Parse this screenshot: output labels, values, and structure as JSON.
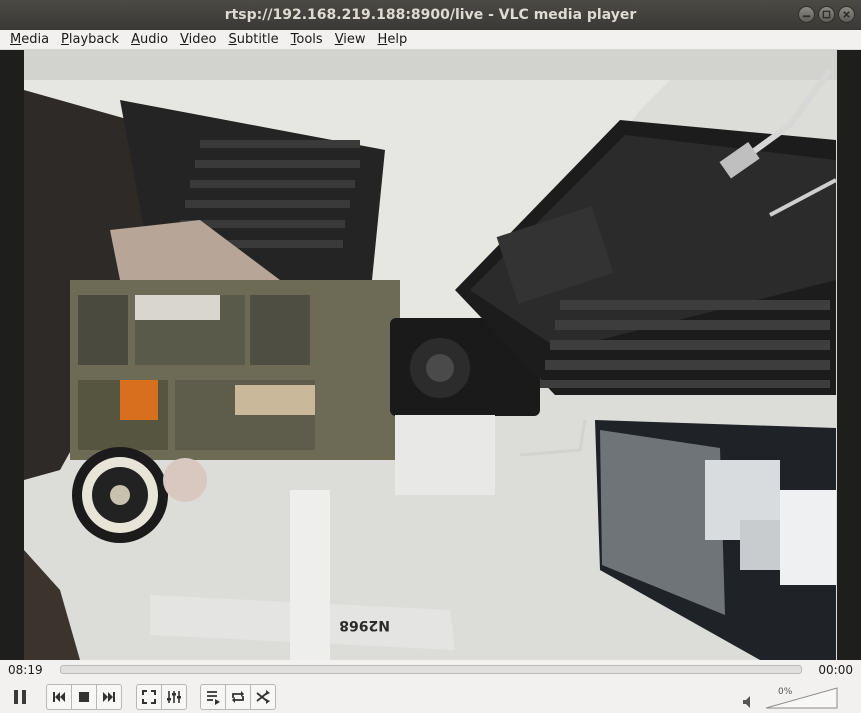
{
  "window": {
    "title": "rtsp://192.168.219.188:8900/live - VLC media player"
  },
  "menu": [
    {
      "first": "M",
      "rest": "edia"
    },
    {
      "first": "P",
      "rest": "layback"
    },
    {
      "first": "A",
      "rest": "udio"
    },
    {
      "first": "V",
      "rest": "ideo"
    },
    {
      "first": "S",
      "rest": "ubtitle"
    },
    {
      "first": "T",
      "rest": "ools"
    },
    {
      "first": "V",
      "rest": "iew"
    },
    {
      "first": "H",
      "rest": "elp"
    }
  ],
  "playback": {
    "elapsed": "08:19",
    "total": "00:00",
    "progress": 0
  },
  "volume": {
    "label": "0%",
    "level": 0
  },
  "video": {
    "plane_registration": "N2968"
  },
  "icons": {
    "minimize": "minimize-icon",
    "maximize": "maximize-icon",
    "close": "close-icon",
    "pause": "pause-icon",
    "previous": "previous-icon",
    "stop": "stop-icon",
    "next": "next-icon",
    "fullscreen": "fullscreen-icon",
    "extended": "extended-settings-icon",
    "playlist": "playlist-icon",
    "loop": "loop-icon",
    "shuffle": "shuffle-icon",
    "speaker": "speaker-icon"
  }
}
